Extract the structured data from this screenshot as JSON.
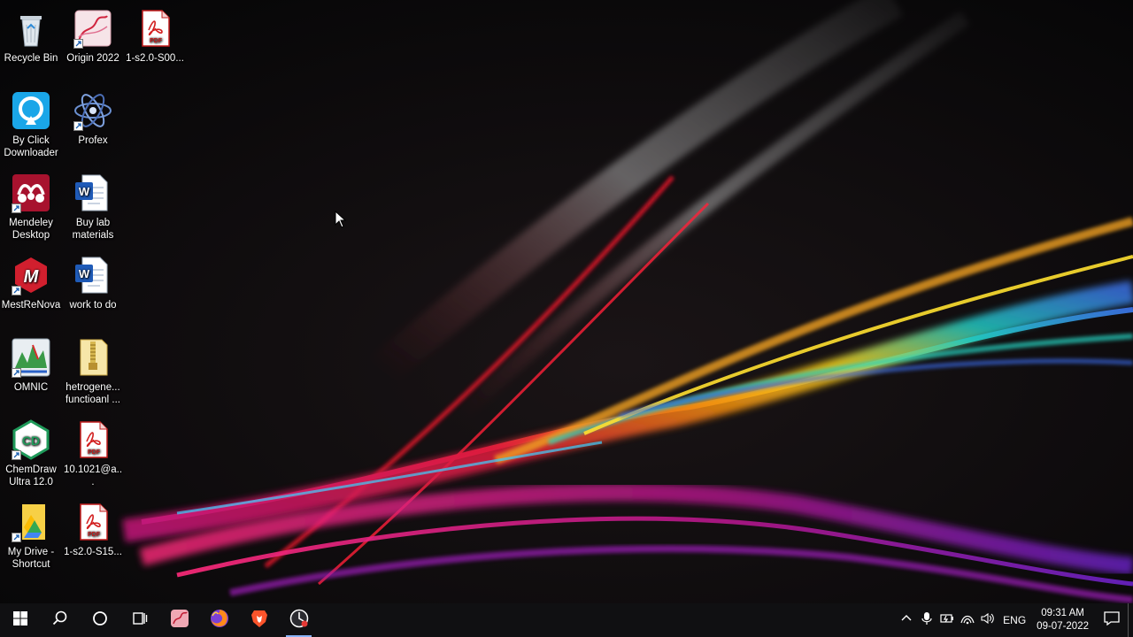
{
  "desktop": {
    "icons": [
      {
        "label": "Recycle Bin",
        "icon": "recycle-bin-icon"
      },
      {
        "label": "Origin 2022",
        "icon": "origin-icon"
      },
      {
        "label": "1-s2.0-S00...",
        "icon": "pdf-file-icon"
      },
      {
        "label": "By Click Downloader",
        "icon": "byclick-downloader-icon"
      },
      {
        "label": "Profex",
        "icon": "profex-icon"
      },
      {
        "label": "Mendeley Desktop",
        "icon": "mendeley-icon"
      },
      {
        "label": "Buy lab materials",
        "icon": "word-document-icon"
      },
      {
        "label": "MestReNova",
        "icon": "mestrenova-icon"
      },
      {
        "label": "work to do",
        "icon": "word-document-icon"
      },
      {
        "label": "OMNIC",
        "icon": "omnic-icon"
      },
      {
        "label": "hetrogene... functioanl ...",
        "icon": "folder-archive-icon"
      },
      {
        "label": "ChemDraw Ultra 12.0",
        "icon": "chemdraw-icon"
      },
      {
        "label": "10.1021@a...",
        "icon": "pdf-file-icon"
      },
      {
        "label": "My Drive - Shortcut",
        "icon": "google-drive-icon"
      },
      {
        "label": "1-s2.0-S15...",
        "icon": "pdf-file-icon"
      }
    ]
  },
  "taskbar": {
    "start": "windows-start-icon",
    "search": "search-icon",
    "cortana": "cortana-circle-icon",
    "task_view": "task-view-icon",
    "pinned": [
      "origin-taskbar-icon",
      "firefox-icon",
      "brave-icon",
      "obs-recorder-icon"
    ],
    "tray": {
      "language": "ENG",
      "time": "09:31 AM",
      "date": "09-07-2022"
    }
  },
  "colors": {
    "taskbar_bg": "#101012",
    "active_indicator": "#8ab4f8",
    "desktop_bg": "#050506"
  }
}
